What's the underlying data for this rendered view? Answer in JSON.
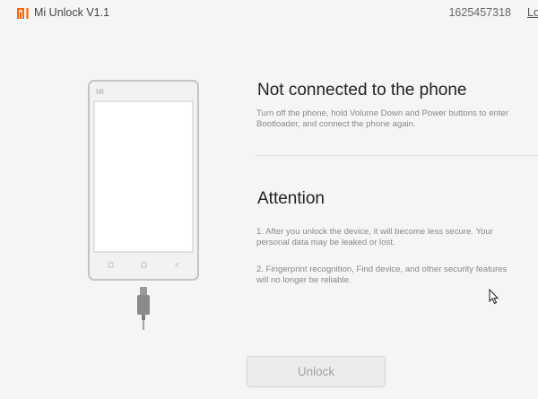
{
  "window": {
    "logo_text": "MI",
    "title": "Mi Unlock  V1.1",
    "user_id": "1625457318",
    "login_link": "Lo"
  },
  "status": {
    "heading": "Not connected to the phone",
    "line1": "Turn off the phone, hold Volume Down and Power buttons to enter",
    "line2": "Bootloader, and connect the phone again."
  },
  "attention": {
    "heading": "Attention",
    "item1_line1": "1. After you unlock the device, it will become less secure. Your",
    "item1_line2": "personal data may be leaked or lost.",
    "item2_line1": "2. Fingerprint recognition, Find device, and other security features",
    "item2_line2": "will no longer be reliable."
  },
  "actions": {
    "unlock_label": "Unlock",
    "unlock_enabled": false
  },
  "colors": {
    "brand": "#ff6700",
    "phone_outline": "#c4c4c4",
    "cable": "#888888"
  },
  "icons": {
    "logo": "mi-logo-icon",
    "phone": "phone-illustration",
    "cable": "usb-cable-icon",
    "cursor": "mouse-pointer-icon"
  }
}
